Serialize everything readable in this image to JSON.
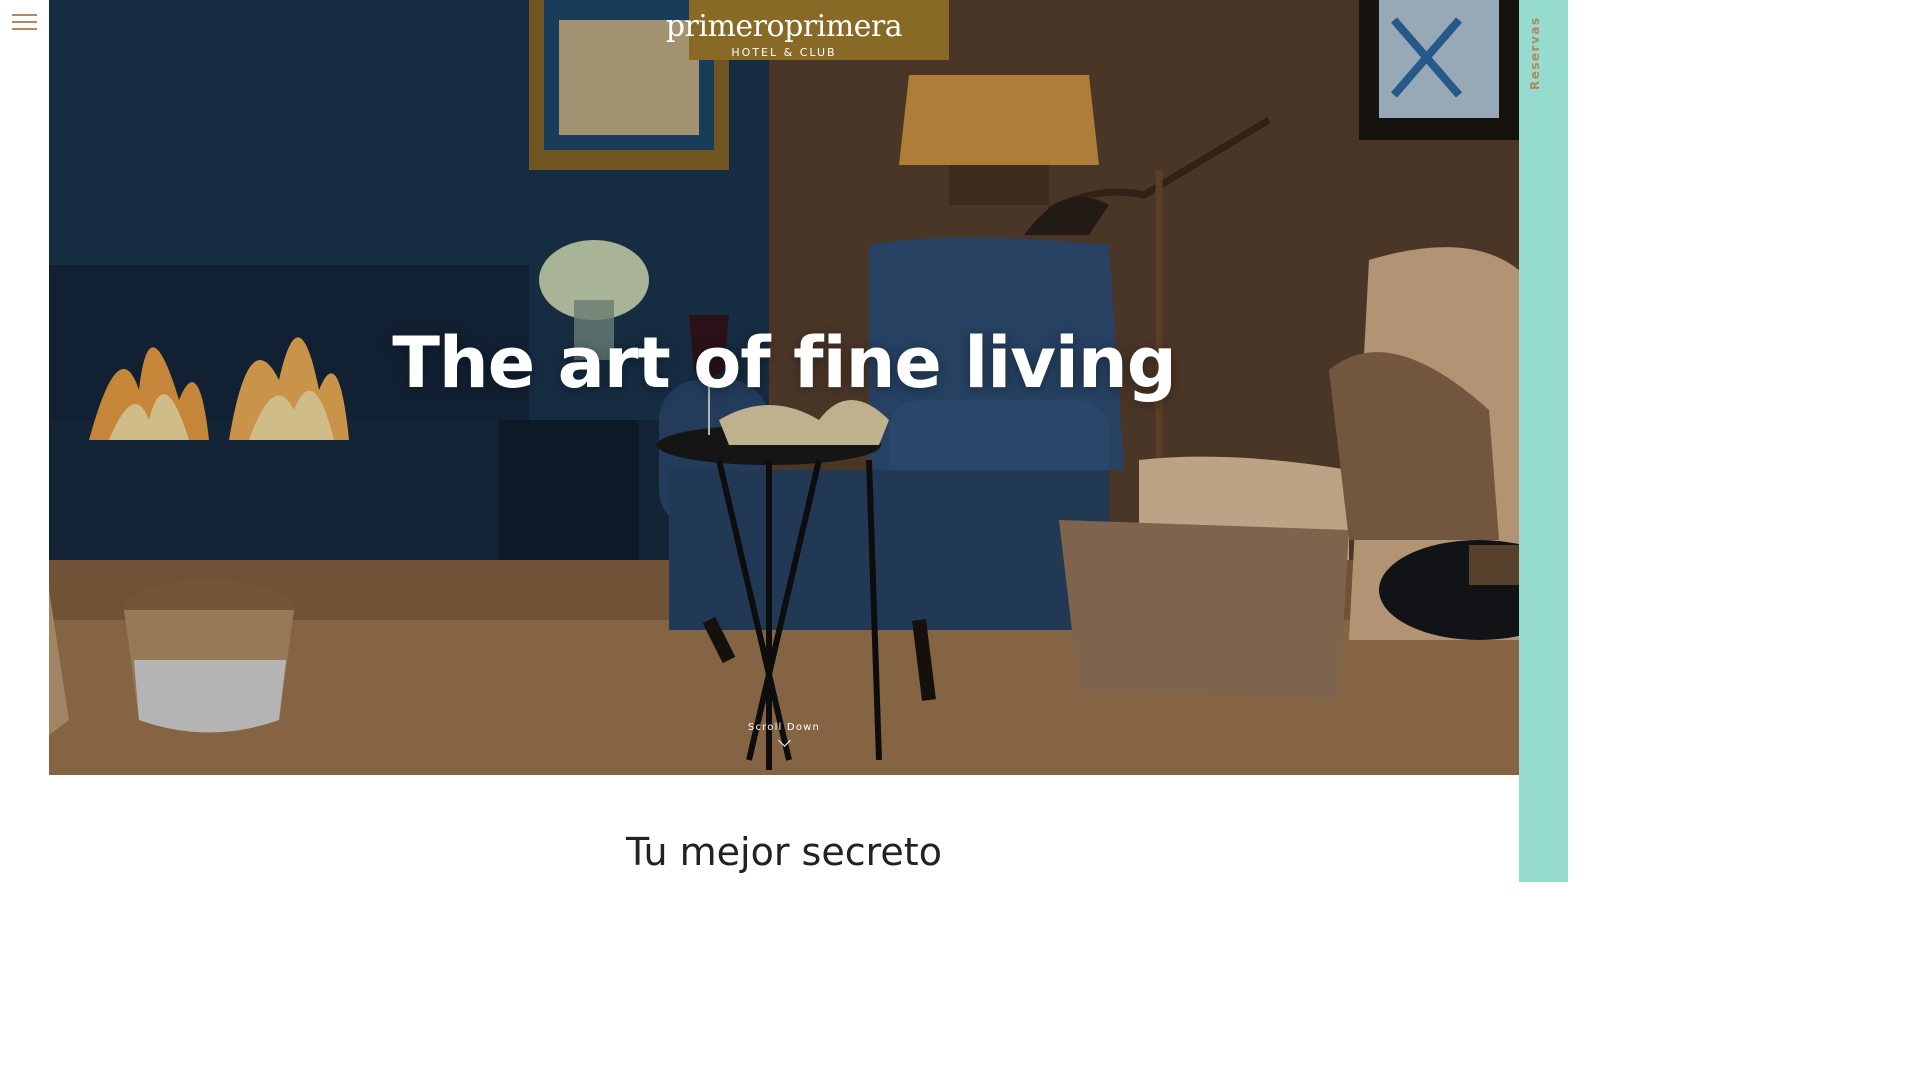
{
  "header": {
    "logo_main": "primeroprimera",
    "logo_sub": "HOTEL & CLUB",
    "menu_icon": "hamburger-menu-icon"
  },
  "hero": {
    "title": "The art of fine living",
    "scroll_label": "Scroll Down",
    "scroll_icon": "chevron-down-icon"
  },
  "sidebar": {
    "reservas_label": "Reservas"
  },
  "intro": {
    "title": "Tu mejor secreto"
  },
  "colors": {
    "accent_copper": "#b8865e",
    "reservas_bg": "#95dccf",
    "text_dark": "#222222"
  }
}
